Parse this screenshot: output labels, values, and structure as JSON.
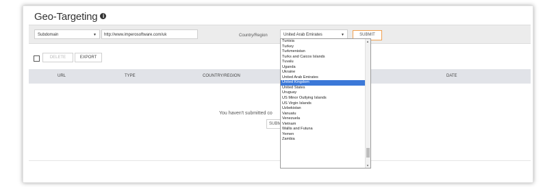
{
  "page": {
    "title": "Geo-Targeting",
    "info_icon": "i"
  },
  "filters": {
    "type_select": "Subdomain",
    "url_value": "http://www.imperosoftware.com/uk",
    "country_label": "Country/Region",
    "country_select": "United Arab Emirates",
    "submit_label": "SUBMIT"
  },
  "actions": {
    "delete_label": "DELETE",
    "export_label": "EXPORT"
  },
  "table": {
    "columns": [
      "URL",
      "TYPE",
      "COUNTRY/REGION",
      "DATE"
    ],
    "empty_message": "You haven't submitted co",
    "empty_submit": "SUBMI"
  },
  "dropdown": {
    "options": [
      "Tunisia",
      "Turkey",
      "Turkmenistan",
      "Turks and Caicos Islands",
      "Tuvalu",
      "Uganda",
      "Ukraine",
      "United Arab Emirates",
      "United Kingdom",
      "United States",
      "Uruguay",
      "US Minor Outlying Islands",
      "US Virgin Islands",
      "Uzbekistan",
      "Vanuatu",
      "Venezuela",
      "Vietnam",
      "Wallis and Futuna",
      "Yemen",
      "Zambia"
    ],
    "highlighted": "United Kingdom"
  },
  "colors": {
    "accent_orange": "#f0a050",
    "highlight_blue": "#3b78d8",
    "header_bg": "#e1e3e8"
  }
}
